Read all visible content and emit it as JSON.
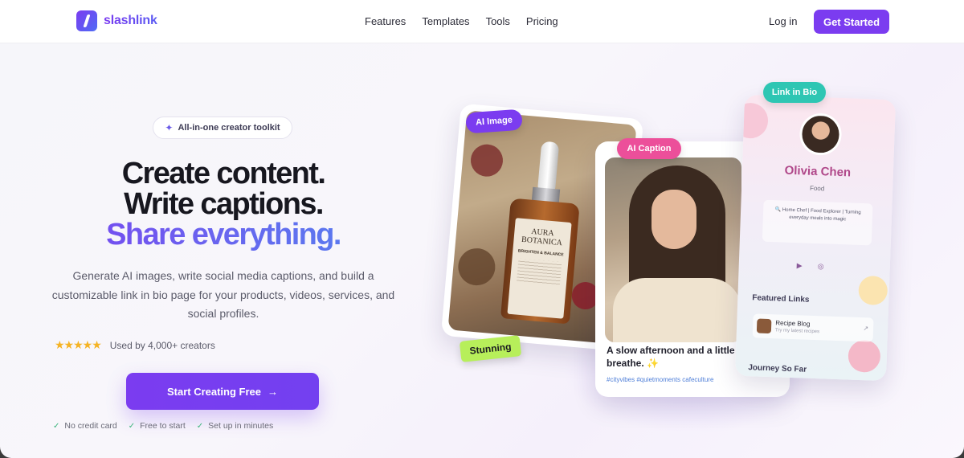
{
  "nav": {
    "brand": "slashlink",
    "links": [
      "Features",
      "Templates",
      "Tools",
      "Pricing"
    ],
    "login": "Log in",
    "cta": "Get Started"
  },
  "hero": {
    "badge": "All-in-one creator toolkit",
    "headline_1": "Create content.",
    "headline_2": "Write captions.",
    "headline_3": "Share everything.",
    "subtitle": "Generate AI images, write social media captions, and build a customizable link in bio page for your products, videos, services, and social profiles.",
    "rating_stars": 5,
    "rating_text": "Used by 4,000+ creators",
    "cta": "Start Creating Free",
    "checks": [
      "No credit card",
      "Free to start",
      "Set up in minutes"
    ]
  },
  "showcase": {
    "tag_ai_image": "AI Image",
    "tag_ai_caption": "AI Caption",
    "tag_link_in_bio": "Link in Bio",
    "stunning": "Stunning",
    "product_brand": "AURA BOTANICA",
    "product_line": "BRIGHTEN & BALANCE",
    "caption_text": "A slow afternoon and a little r",
    "caption_text_2": "breathe. ✨",
    "hashtags": "#cityvibes #quietmoments cafeculture",
    "profile_name": "Olivia Chen",
    "profile_category": "Food",
    "profile_bio": "🔍 Home Chef | Food Explorer | Turning everyday meals into magic",
    "featured_links": "Featured Links",
    "link_title": "Recipe Blog",
    "link_desc": "Try my latest recipes",
    "journey": "Journey So Far"
  },
  "colors": {
    "accent": "#7b3cf0",
    "caption_tag": "#ec4f9a",
    "bio_tag": "#2ec6b3",
    "stunning_tag": "#b7ef5a",
    "stars": "#f5b324"
  }
}
